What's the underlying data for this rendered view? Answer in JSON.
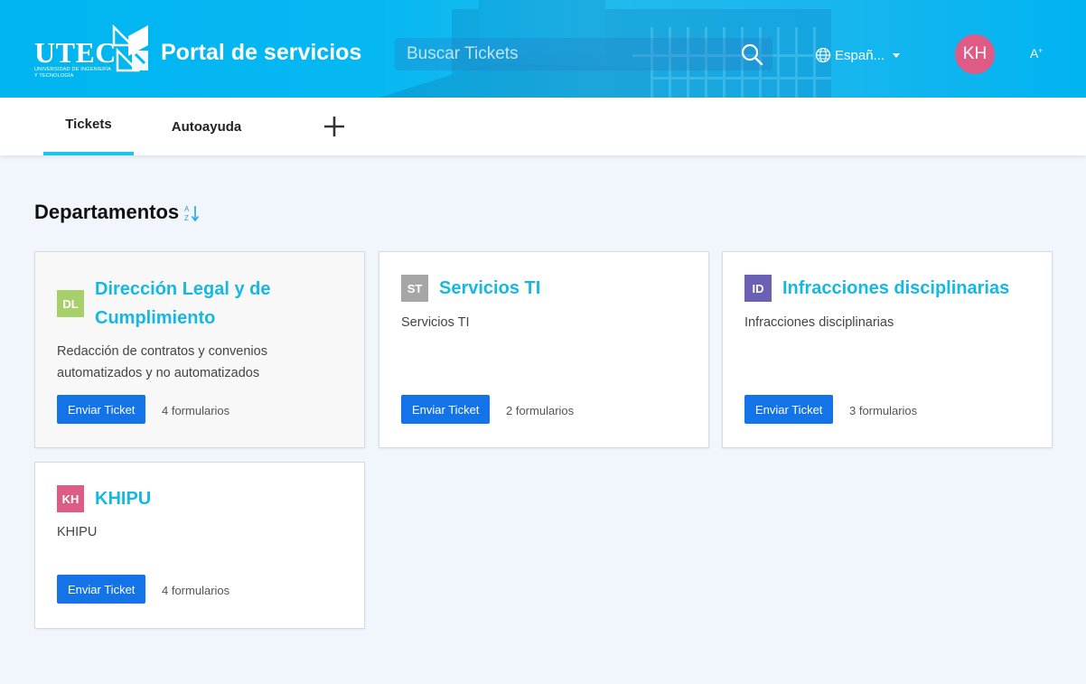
{
  "header": {
    "logo_text": "UTEC",
    "logo_subtitle": "UNIVERSIDAD DE INGENIERÍA Y TECNOLOGÍA",
    "title": "Portal de servicios",
    "search": {
      "placeholder": "Buscar Tickets",
      "value": ""
    },
    "language": {
      "label": "Españ..."
    },
    "user_initials": "KH",
    "font_toggle": "A",
    "brand_color": "#00b5f0"
  },
  "tabs": [
    {
      "label": "Tickets",
      "active": true
    },
    {
      "label": "Autoayuda",
      "active": false
    }
  ],
  "section": {
    "title": "Departamentos"
  },
  "departments": [
    {
      "initials": "DL",
      "color": "#a7d06b",
      "title_line1": "Dirección Legal y de",
      "title_line2": "Cumplimiento",
      "description_line1": "Redacción de contratos y convenios",
      "description_line2": "automatizados y no automatizados",
      "button": "Enviar Ticket",
      "forms": "4 formularios"
    },
    {
      "initials": "ST",
      "color": "#a6a6a6",
      "title": "Servicios TI",
      "description": "Servicios TI",
      "button": "Enviar Ticket",
      "forms": "2 formularios"
    },
    {
      "initials": "ID",
      "color": "#6a60b4",
      "title": "Infracciones disciplinarias",
      "description": "Infracciones disciplinarias",
      "button": "Enviar Ticket",
      "forms": "3 formularios"
    },
    {
      "initials": "KH",
      "color": "#dc5c83",
      "title": "KHIPU",
      "description": "KHIPU",
      "button": "Enviar Ticket",
      "forms": "4 formularios"
    }
  ]
}
